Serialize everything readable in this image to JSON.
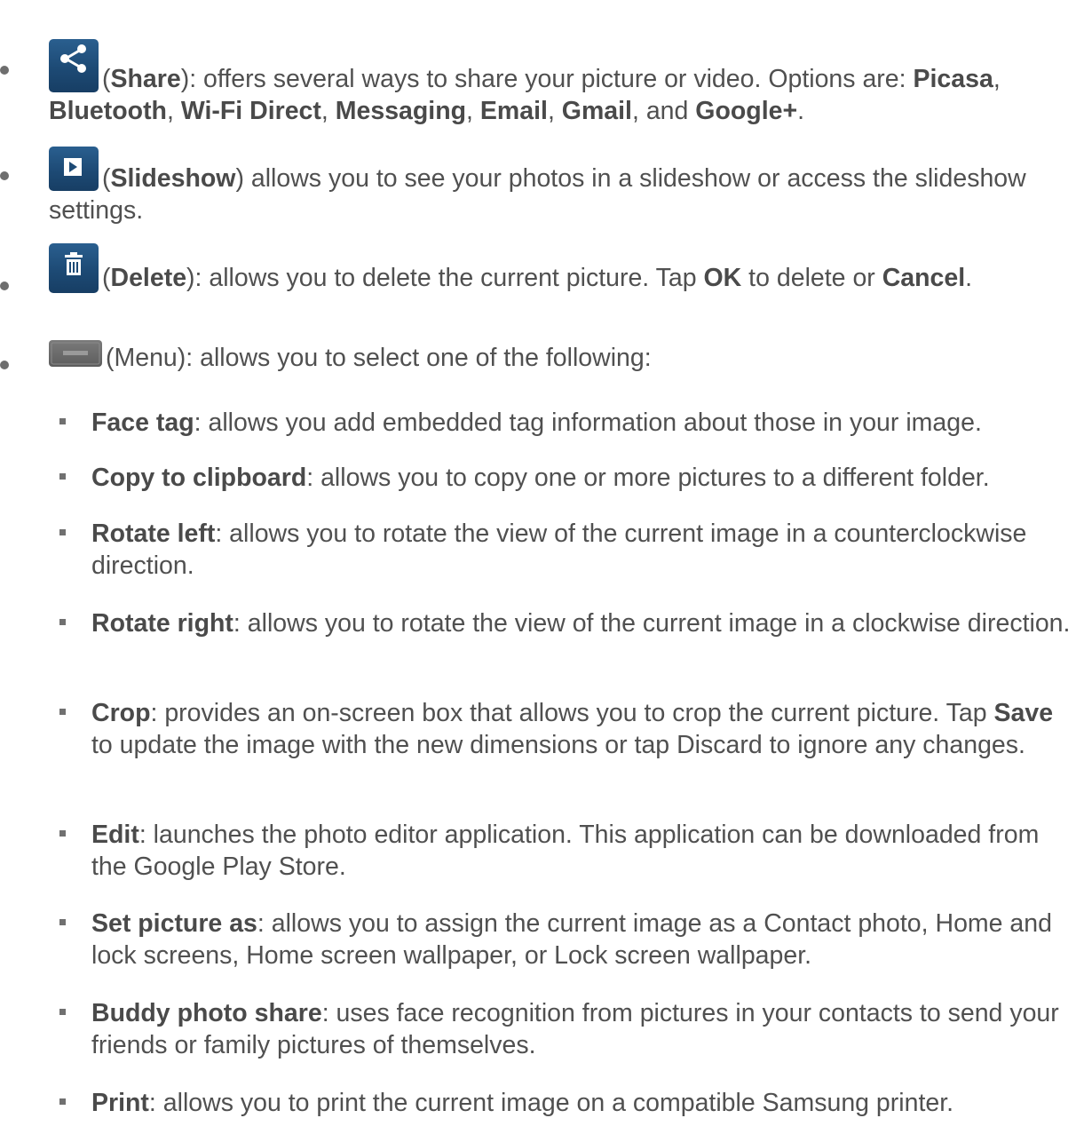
{
  "items": [
    {
      "icon": "share-icon",
      "paren_open": "(",
      "name": "Share",
      "after": "): offers several ways to share your picture or video. Options are: ",
      "opt1": "Picasa",
      "sep1": ", ",
      "opt2": "Bluetooth",
      "sep2": ", ",
      "opt3": "Wi-Fi Direct",
      "sep3": ", ",
      "opt4": "Messaging",
      "sep4": ", ",
      "opt5": "Email",
      "sep5": ", ",
      "opt6": "Gmail",
      "sep6": ", and ",
      "opt7": "Google+",
      "end": "."
    },
    {
      "icon": "slideshow-icon",
      "paren_open": "(",
      "name": "Slideshow",
      "after": ") allows you to see your photos in  a slideshow or access the slideshow settings."
    },
    {
      "icon": "delete-icon",
      "paren_open": "(",
      "name": "Delete",
      "after": "): allows you to delete the current picture. Tap ",
      "ok": "OK",
      "mid": " to delete or ",
      "cancel": "Cancel",
      "end": "."
    },
    {
      "icon": "menu-icon",
      "text": "(Menu): allows you to select one of the following:"
    }
  ],
  "menu_options": [
    {
      "term": "Face tag",
      "desc": ": allows you add embedded tag information about those in your image."
    },
    {
      "term": "Copy to clipboard",
      "desc": ": allows you to copy one or more pictures to a different folder."
    },
    {
      "term": "Rotate left",
      "desc": ": allows you to rotate the view of the current image in a counterclockwise direction."
    },
    {
      "term": "Rotate right",
      "desc": ": allows you to rotate the view of the current image in a clockwise direction."
    },
    {
      "term": "Crop",
      "desc": ": provides an on-screen box that allows you to crop the current picture. Tap ",
      "term2": "Save",
      "desc2": " to update the image with the new dimensions or tap Discard to ignore any changes."
    },
    {
      "term": "Edit",
      "desc": ": launches the photo editor application. This application can be downloaded from the Google Play Store."
    },
    {
      "term": "Set picture as",
      "desc": ": allows you to assign the current image as a Contact photo, Home and lock screens, Home screen wallpaper, or Lock screen wallpaper."
    },
    {
      "term": "Buddy photo share",
      "desc": ": uses face recognition from pictures in your contacts to send your friends or family pictures of themselves."
    },
    {
      "term": "Print",
      "desc": ": allows you to print the current image on a compatible Samsung printer."
    }
  ],
  "colors": {
    "icon_blue": "#1d4a75",
    "icon_gray": "#6a6a6a",
    "text": "#505050"
  }
}
